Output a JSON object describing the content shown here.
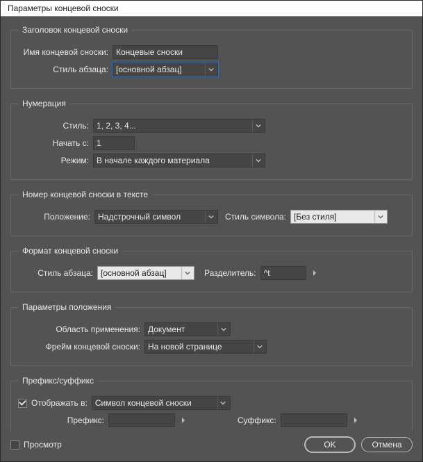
{
  "window": {
    "title": "Параметры концевой сноски"
  },
  "group_header": {
    "legend": "Заголовок концевой сноски",
    "name_label": "Имя концевой сноски:",
    "name_value": "Концевые сноски",
    "parastyle_label": "Стиль абзаца:",
    "parastyle_value": "[основной абзац]"
  },
  "group_numbering": {
    "legend": "Нумерация",
    "style_label": "Стиль:",
    "style_value": "1, 2, 3, 4...",
    "start_label": "Начать с:",
    "start_value": "1",
    "mode_label": "Режим:",
    "mode_value": "В начале каждого материала"
  },
  "group_textnum": {
    "legend": "Номер концевой сноски в тексте",
    "position_label": "Положение:",
    "position_value": "Надстрочный символ",
    "charstyle_label": "Стиль символа:",
    "charstyle_value": "[Без стиля]"
  },
  "group_format": {
    "legend": "Формат концевой сноски",
    "parastyle_label": "Стиль абзаца:",
    "parastyle_value": "[основной абзац]",
    "separator_label": "Разделитель:",
    "separator_value": "^t"
  },
  "group_placement": {
    "legend": "Параметры положения",
    "scope_label": "Область применения:",
    "scope_value": "Документ",
    "frame_label": "Фрейм концевой сноски:",
    "frame_value": "На новой странице"
  },
  "group_prefix": {
    "legend": "Префикс/суффикс",
    "showin_label": "Отображать в:",
    "showin_value": "Символ концевой сноски",
    "prefix_label": "Префикс:",
    "prefix_value": "",
    "suffix_label": "Суффикс:",
    "suffix_value": ""
  },
  "footer": {
    "preview_label": "Просмотр",
    "ok": "OK",
    "cancel": "Отмена"
  }
}
